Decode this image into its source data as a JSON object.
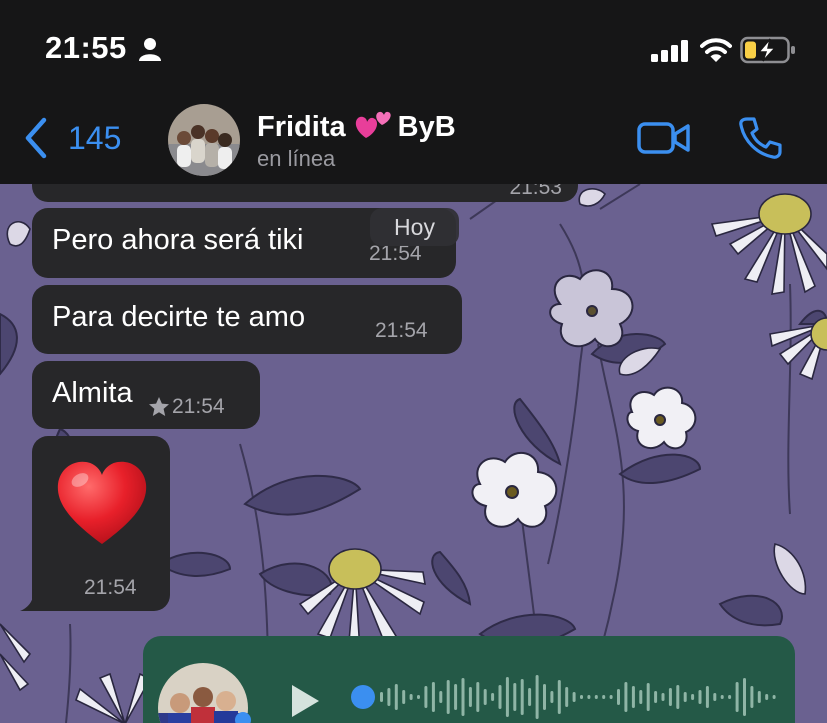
{
  "status_bar": {
    "time": "21:55",
    "icons": [
      "person-icon",
      "signal-icon",
      "wifi-icon",
      "battery-charging-icon"
    ]
  },
  "header": {
    "back_count": "145",
    "title_before": "Fridita",
    "title_after": "ByB",
    "title_emoji": "two-hearts",
    "status": "en línea",
    "accent_color": "#3b8ff0"
  },
  "chat": {
    "date_pill": "Hoy",
    "messages": [
      {
        "text": "",
        "time": "21:53",
        "partial": true
      },
      {
        "text": "Pero ahora será tiki",
        "time": "21:54"
      },
      {
        "text": "Para decirte te amo",
        "time": "21:54"
      },
      {
        "text": "Almita",
        "time": "21:54",
        "starred": true
      },
      {
        "emoji": "red-heart",
        "time": "21:54"
      }
    ],
    "audio_message": {
      "played_fraction": 0
    },
    "colors": {
      "wallpaper": "#6a6190",
      "incoming_bubble": "#272729",
      "outgoing_bubble": "#245947"
    }
  }
}
